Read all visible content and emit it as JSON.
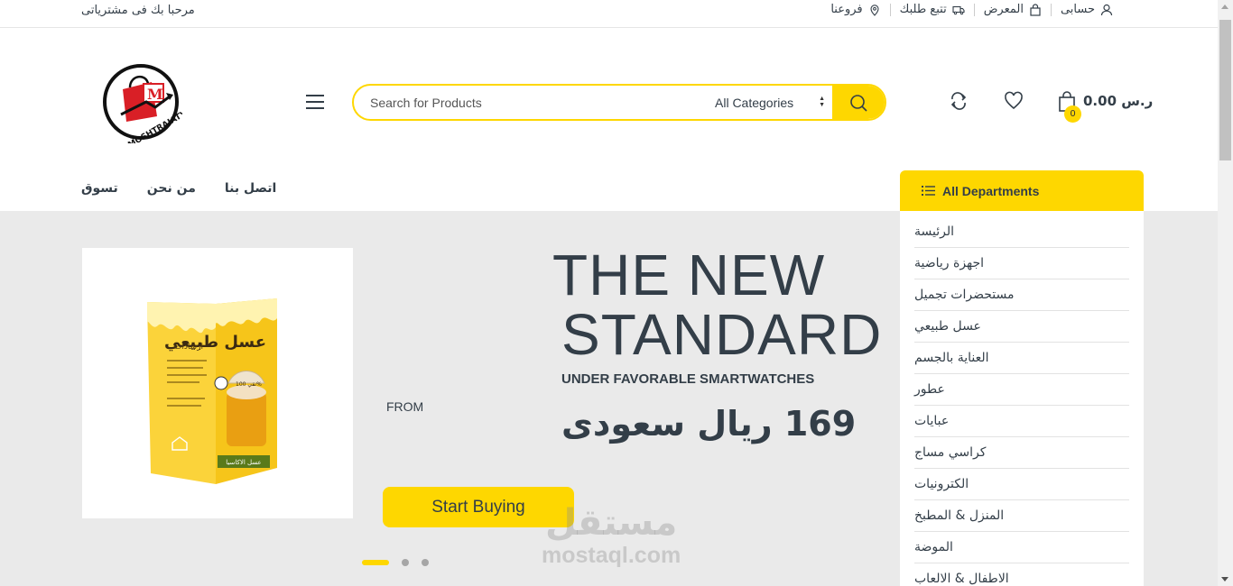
{
  "topbar": {
    "welcome": "مرحبا بك فى مشترياتى",
    "links": [
      {
        "label": "حسابى",
        "icon": "user-icon"
      },
      {
        "label": "المعرض",
        "icon": "shopping-bag-icon"
      },
      {
        "label": "تتبع طلبك",
        "icon": "truck-icon"
      },
      {
        "label": "فروعنا",
        "icon": "map-pin-icon"
      }
    ]
  },
  "header": {
    "logo_text": "MOSHTRAIATY.com",
    "logo_letter": "M",
    "search": {
      "placeholder": "Search for Products",
      "category": "All Categories"
    },
    "cart": {
      "count": "0",
      "total": "0.00 ر.س"
    }
  },
  "nav": {
    "items": [
      "تسوق",
      "من نحن",
      "اتصل بنا"
    ]
  },
  "departments": {
    "title": "All Departments",
    "items": [
      "الرئيسة",
      "اجهزة رياضية",
      "مستحضرات تجميل",
      "عسل طبيعي",
      "العناية بالجسم",
      "عطور",
      "عبايات",
      "كراسي مساج",
      "الكترونيات",
      "المنزل & المطبخ",
      "الموضة",
      "الاطفال & الالعاب"
    ]
  },
  "hero": {
    "headline_1": "THE NEW",
    "headline_2": "STANDARD",
    "subline": "UNDER FAVORABLE SMARTWATCHES",
    "from_label": "FROM",
    "price": "169 ريال سعودى",
    "cta": "Start Buying",
    "slides": 3,
    "active_slide": 0,
    "product_text": {
      "title": "عسل طبيعي",
      "instructions": "ارشادات",
      "purity": "نقي 100%",
      "variety": "عسل الاكاسيا"
    }
  },
  "watermark": {
    "arabic": "مستقل",
    "latin": "mostaql.com"
  },
  "colors": {
    "accent": "#fed700",
    "text": "#333e48",
    "hero_bg": "#eaeaea"
  }
}
